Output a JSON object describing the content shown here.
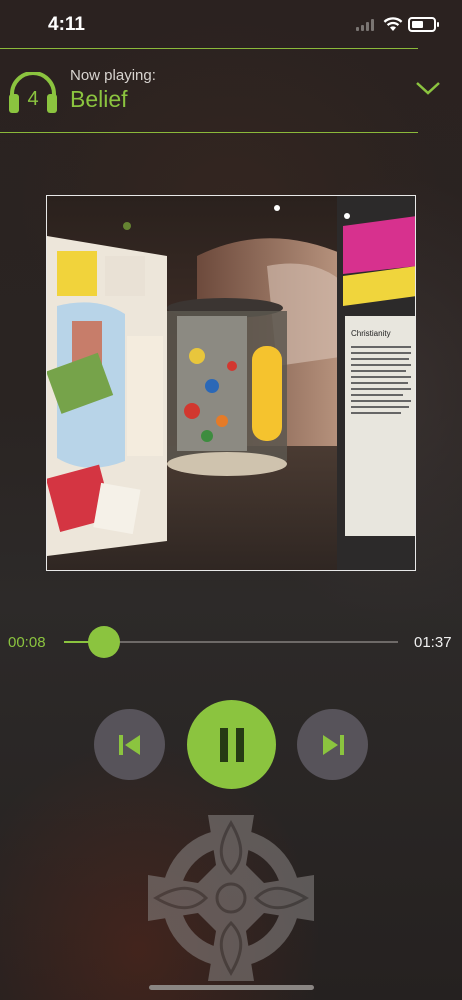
{
  "status_bar": {
    "time": "4:11"
  },
  "now_playing": {
    "track_number": "4",
    "label": "Now playing:",
    "title": "Belief"
  },
  "artwork": {
    "icon": "exhibition-photo",
    "panel_headings": [
      "Christianity"
    ]
  },
  "player": {
    "elapsed": "00:08",
    "duration": "01:37",
    "progress_fraction": 0.12,
    "state": "playing"
  },
  "icons": {
    "track": "headphones-icon",
    "collapse": "chevron-down-icon",
    "previous": "skip-previous-icon",
    "pause": "pause-icon",
    "next": "skip-next-icon",
    "emblem": "celtic-cross-icon"
  },
  "colors": {
    "accent": "#8bc43f",
    "button_secondary": "#57535a",
    "divider": "#8bb93a"
  }
}
